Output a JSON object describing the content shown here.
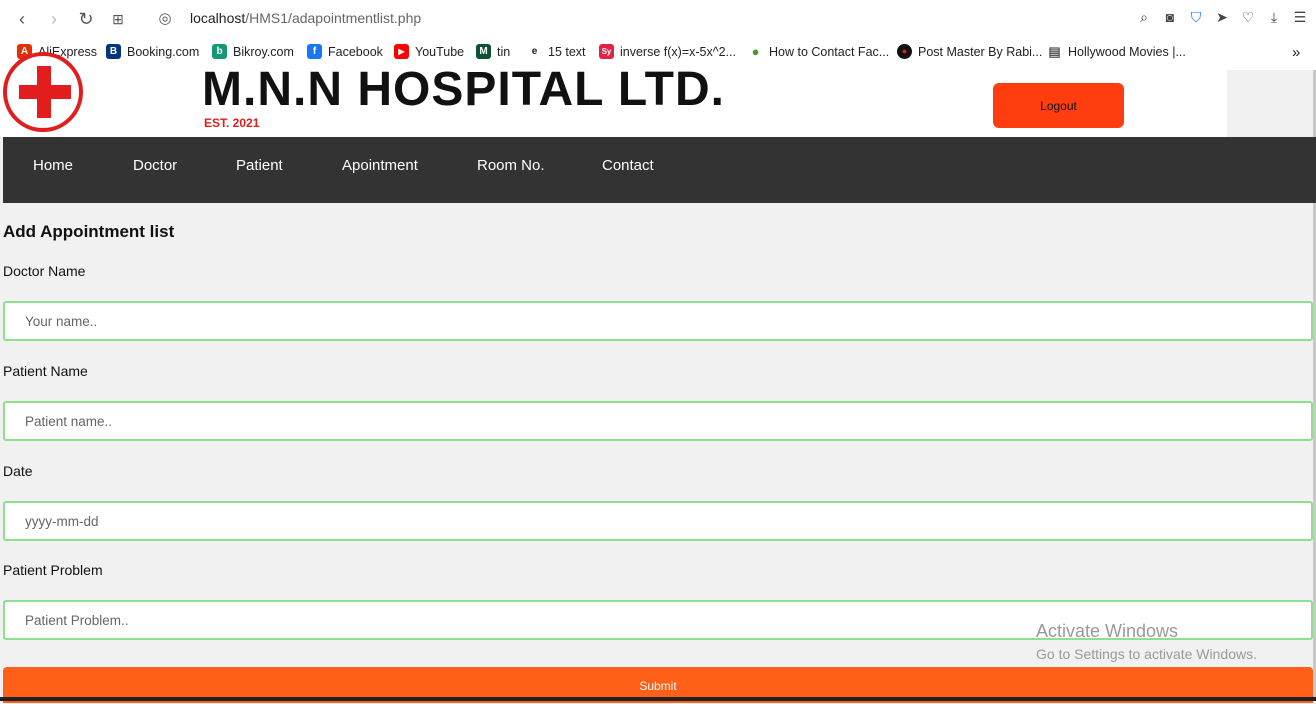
{
  "browser": {
    "url_host": "localhost",
    "url_path": "/HMS1/adapointmentlist.php",
    "bookmarks": [
      {
        "label": "AliExpress",
        "color": "#e62e04",
        "glyph": "A"
      },
      {
        "label": "Booking.com",
        "color": "#003580",
        "glyph": "B"
      },
      {
        "label": "Bikroy.com",
        "color": "#149777",
        "glyph": "b"
      },
      {
        "label": "Facebook",
        "color": "#1877f2",
        "glyph": "f"
      },
      {
        "label": "YouTube",
        "color": "#ff0000",
        "glyph": "▶"
      },
      {
        "label": "tin",
        "color": "#0f5132",
        "glyph": "M"
      },
      {
        "label": "15 text",
        "color": "#222222",
        "glyph": "e"
      },
      {
        "label": "inverse f(x)=x-5x^2...",
        "color": "#e02444",
        "glyph": "Sy"
      },
      {
        "label": "How to Contact Fac...",
        "color": "#4c9a2a",
        "glyph": "●"
      },
      {
        "label": "Post Master By Rabi...",
        "color": "#111111",
        "glyph": "●"
      },
      {
        "label": "Hollywood Movies |...",
        "color": "#555555",
        "glyph": "▤"
      }
    ]
  },
  "header": {
    "title": "M.N.N HOSPITAL LTD.",
    "established": "EST. 2021",
    "logout_label": "Logout"
  },
  "nav": {
    "items": [
      "Home",
      "Doctor",
      "Patient",
      "Apointment",
      "Room No.",
      "Contact"
    ]
  },
  "form": {
    "title": "Add Appointment list",
    "doctor_label": "Doctor Name",
    "doctor_placeholder": "Your name..",
    "patient_label": "Patient Name",
    "patient_placeholder": "Patient name..",
    "date_label": "Date",
    "date_placeholder": "yyyy-mm-dd",
    "problem_label": "Patient Problem",
    "problem_placeholder": "Patient Problem..",
    "submit_label": "Submit"
  },
  "watermark": {
    "line1": "Activate Windows",
    "line2": "Go to Settings to activate Windows."
  }
}
